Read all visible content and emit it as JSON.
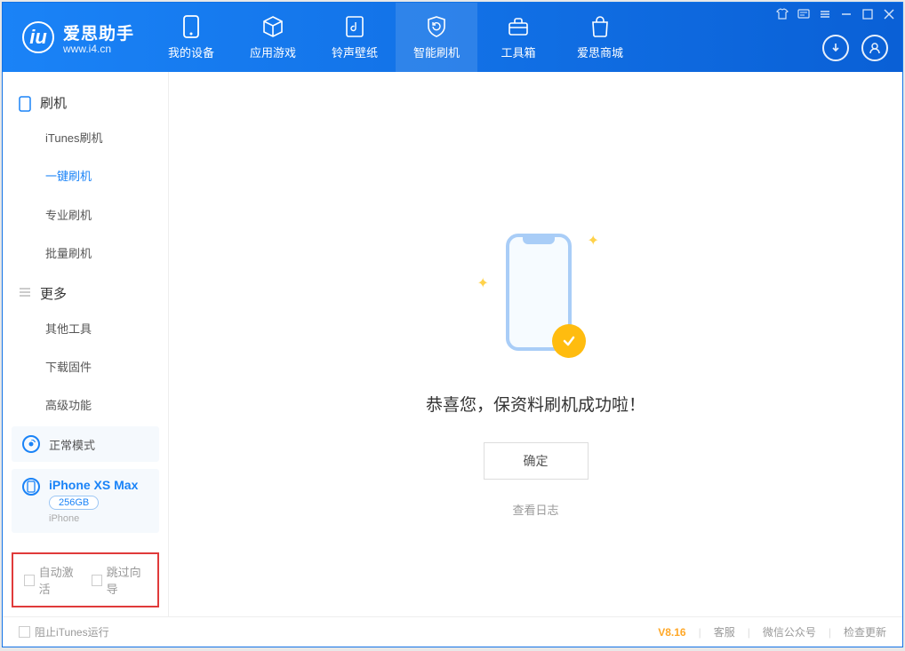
{
  "brand": {
    "name": "爱思助手",
    "url": "www.i4.cn"
  },
  "nav": {
    "my_device": "我的设备",
    "apps_games": "应用游戏",
    "ring_wall": "铃声壁纸",
    "smart_flash": "智能刷机",
    "toolbox": "工具箱",
    "store": "爱思商城"
  },
  "sidebar": {
    "flash_group": "刷机",
    "items": {
      "itunes": "iTunes刷机",
      "onekey": "一键刷机",
      "pro": "专业刷机",
      "batch": "批量刷机"
    },
    "more_group": "更多",
    "more_items": {
      "other_tools": "其他工具",
      "download_fw": "下载固件",
      "advanced": "高级功能"
    }
  },
  "device_mode": {
    "label": "正常模式"
  },
  "device": {
    "name": "iPhone XS Max",
    "capacity": "256GB",
    "model": "iPhone"
  },
  "bottom_checks": {
    "auto_activate": "自动激活",
    "skip_guide": "跳过向导"
  },
  "main": {
    "success": "恭喜您，保资料刷机成功啦！",
    "ok": "确定",
    "view_log": "查看日志"
  },
  "status": {
    "block_itunes": "阻止iTunes运行",
    "version": "V8.16",
    "service": "客服",
    "wechat": "微信公众号",
    "check_update": "检查更新"
  }
}
